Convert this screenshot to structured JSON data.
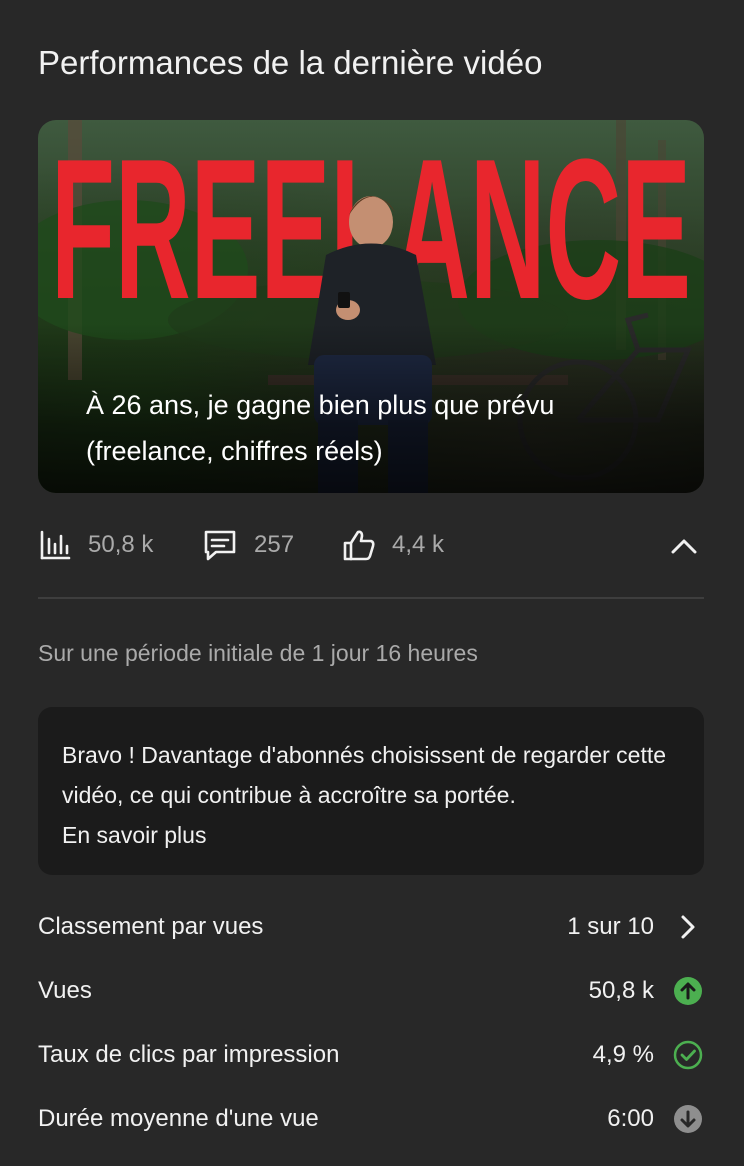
{
  "section": {
    "title": "Performances de la dernière vidéo"
  },
  "video": {
    "thumbnail_text": "FREELANCE",
    "title": "À 26 ans, je gagne bien plus que prévu (freelance, chiffres réels)"
  },
  "stats": {
    "views": {
      "icon": "bar-chart-icon",
      "value": "50,8 k"
    },
    "comments": {
      "icon": "comment-icon",
      "value": "257"
    },
    "likes": {
      "icon": "thumb-up-icon",
      "value": "4,4 k"
    },
    "collapse_icon": "chevron-up-icon"
  },
  "period": "Sur une période initiale de 1 jour 16 heures",
  "notice": {
    "text": "Bravo ! Davantage d'abonnés choisissent de regarder cette vidéo, ce qui contribue à accroître sa portée.",
    "link": "En savoir plus"
  },
  "metrics": [
    {
      "label": "Classement par vues",
      "value": "1 sur 10",
      "icon": "chevron-right-icon"
    },
    {
      "label": "Vues",
      "value": "50,8 k",
      "icon": "arrow-up-circle-icon",
      "status": "above-typical"
    },
    {
      "label": "Taux de clics par impression",
      "value": "4,9 %",
      "icon": "check-circle-icon",
      "status": "typical"
    },
    {
      "label": "Durée moyenne d'une vue",
      "value": "6:00",
      "icon": "arrow-down-circle-icon",
      "status": "below-typical"
    }
  ],
  "colors": {
    "background": "#282828",
    "notice_bg": "#1b1b1b",
    "thumbnail_red": "#e8262d",
    "positive_green": "#4caf50",
    "neutral_gray": "#8e8e8e"
  }
}
